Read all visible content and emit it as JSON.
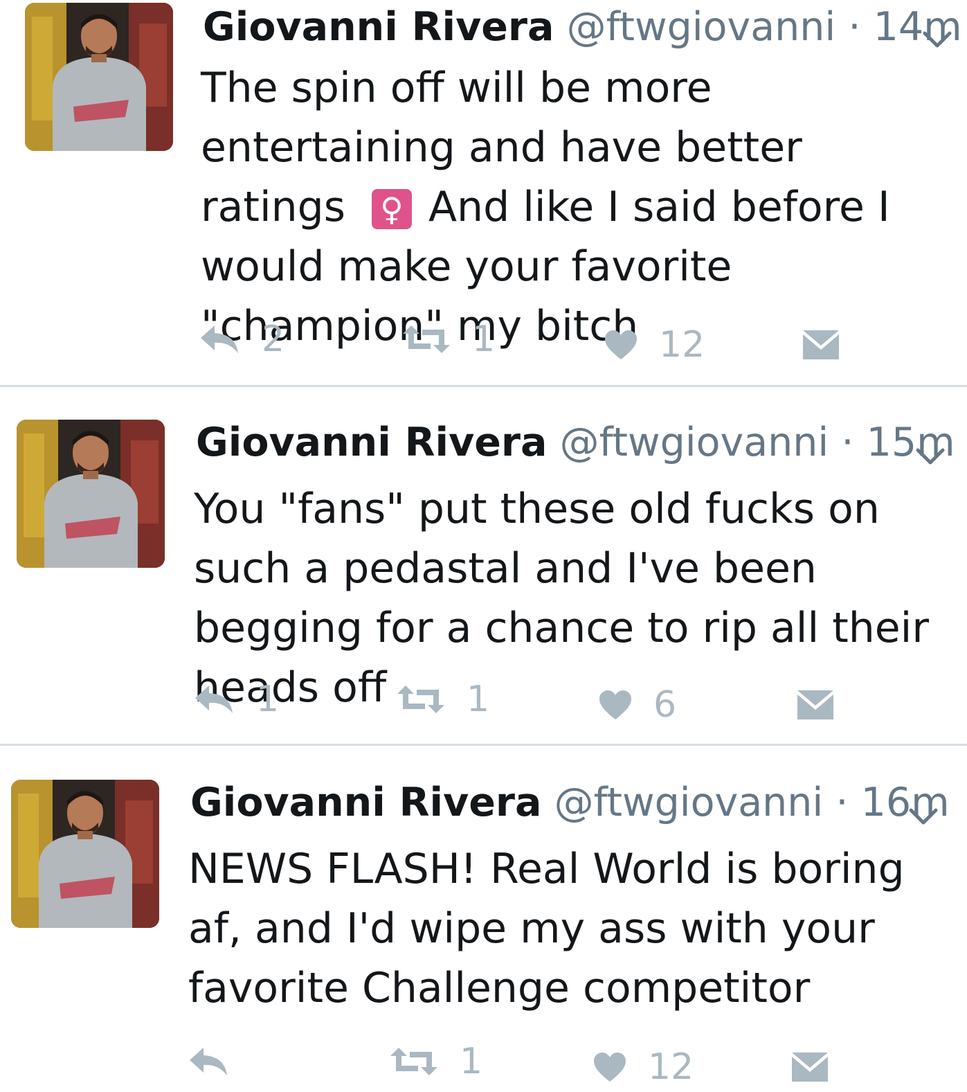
{
  "tweets": [
    {
      "name": "Giovanni Rivera",
      "handle": "@ftwgiovanni",
      "dot": "·",
      "time": "14m",
      "text_part1": "The spin off will be more entertaining and have better ratings",
      "emoji": "♀",
      "text_part2": "And like I said before I would make your favorite \"champion\" my bitch",
      "replies": "2",
      "retweets": "1",
      "likes": "12"
    },
    {
      "name": "Giovanni Rivera",
      "handle": "@ftwgiovanni",
      "dot": "·",
      "time": "15m",
      "text": "You \"fans\" put these old fucks on such a pedastal and I've been begging for a chance to rip all their heads off",
      "replies": "1",
      "retweets": "1",
      "likes": "6"
    },
    {
      "name": "Giovanni Rivera",
      "handle": "@ftwgiovanni",
      "dot": "·",
      "time": "16m",
      "text": "NEWS FLASH! Real World is boring af, and I'd wipe my ass with your favorite Challenge competitor",
      "replies": "",
      "retweets": "1",
      "likes": "12"
    }
  ],
  "colors": {
    "text": "#14171a",
    "secondary": "#657786",
    "action_gray": "#aab8c2",
    "divider": "#d6dde3",
    "emoji_bg": "#e0528a"
  },
  "icons": {
    "reply": "reply-icon",
    "retweet": "retweet-icon",
    "like": "heart-icon",
    "dm": "envelope-icon",
    "caret": "chevron-down-icon"
  }
}
